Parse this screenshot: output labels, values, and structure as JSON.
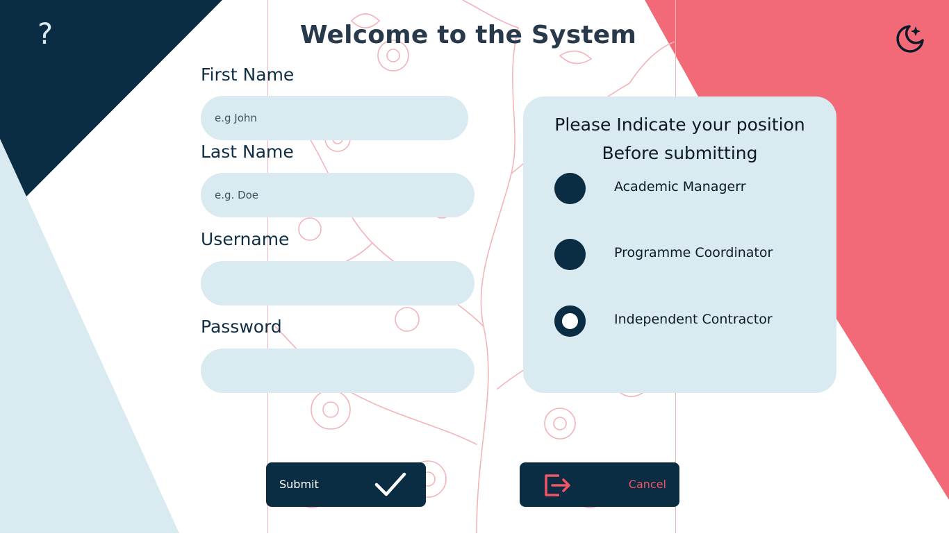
{
  "header": {
    "title": "Welcome to the System",
    "help_glyph": "?",
    "help_icon": "question-mark-icon",
    "theme_icon": "moon-star-icon"
  },
  "form": {
    "first_name": {
      "label": "First Name",
      "placeholder": "e.g John",
      "value": ""
    },
    "last_name": {
      "label": "Last Name",
      "placeholder": "e.g. Doe",
      "value": ""
    },
    "username": {
      "label": "Username",
      "placeholder": "",
      "value": ""
    },
    "password": {
      "label": "Password",
      "placeholder": "",
      "value": ""
    }
  },
  "position": {
    "title_line1": "Please Indicate your position",
    "title_line2": "Before submitting",
    "options": [
      {
        "label": "Academic Managerr",
        "selected": false
      },
      {
        "label": "Programme Coordinator",
        "selected": false
      },
      {
        "label": "Independent Contractor",
        "selected": true
      }
    ]
  },
  "actions": {
    "submit_label": "Submit",
    "submit_icon": "checkmark-icon",
    "cancel_label": "Cancel",
    "cancel_icon": "exit-icon"
  },
  "colors": {
    "navy": "#0a2d44",
    "coral": "#f26a78",
    "light_blue": "#d9ebf1",
    "floral_pink": "#f4b3b8",
    "cancel_red": "#f05565"
  }
}
